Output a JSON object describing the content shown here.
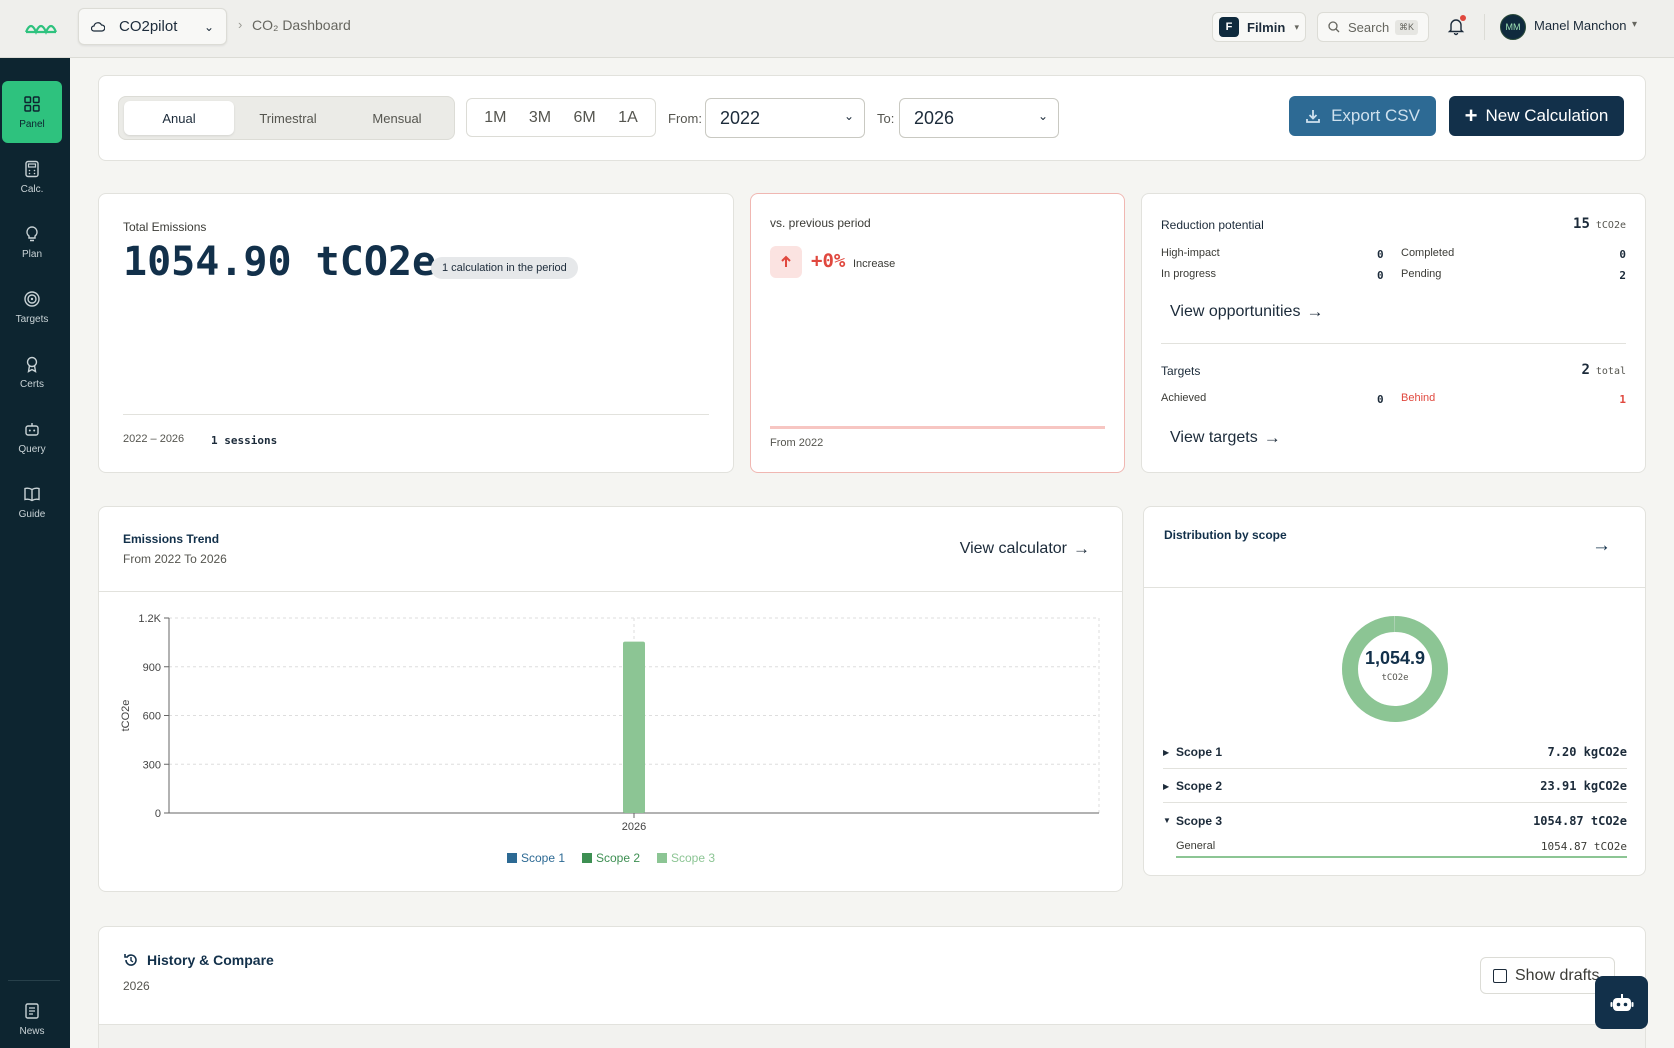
{
  "topbar": {
    "app_name": "CO2pilot",
    "breadcrumb": "CO₂ Dashboard",
    "org_initial": "F",
    "org_name": "Filmin",
    "search_label": "Search",
    "search_shortcut": "⌘K",
    "user_initials": "MM",
    "user_name": "Manel Manchon"
  },
  "sidebar": {
    "items": [
      {
        "label": "Panel",
        "icon": "grid-icon"
      },
      {
        "label": "Calc.",
        "icon": "calculator-icon"
      },
      {
        "label": "Plan",
        "icon": "lightbulb-icon"
      },
      {
        "label": "Targets",
        "icon": "target-icon"
      },
      {
        "label": "Certs",
        "icon": "award-icon"
      },
      {
        "label": "Query",
        "icon": "robot-icon"
      },
      {
        "label": "Guide",
        "icon": "book-icon"
      }
    ],
    "footer": {
      "label": "News",
      "icon": "newspaper-icon"
    }
  },
  "filters": {
    "periods": [
      "Anual",
      "Trimestral",
      "Mensual"
    ],
    "active_period": "Anual",
    "ranges": [
      "1M",
      "3M",
      "6M",
      "1A"
    ],
    "from_label": "From:",
    "from_value": "2022",
    "to_label": "To:",
    "to_value": "2026",
    "export_label": "Export CSV",
    "new_label": "New Calculation"
  },
  "total": {
    "title": "Total Emissions",
    "value": "1054.90 tCO2e",
    "badge": "1 calculation in the period",
    "range": "2022 – 2026",
    "sessions": "1 sessions"
  },
  "comparison": {
    "title": "vs. previous period",
    "change": "+0%",
    "change_label": "Increase",
    "footer": "From 2022"
  },
  "reduction": {
    "title": "Reduction potential",
    "total": "15",
    "total_unit": "tCO2e",
    "high_impact_label": "High-impact",
    "high_impact": "0",
    "completed_label": "Completed",
    "completed": "0",
    "in_progress_label": "In progress",
    "in_progress": "0",
    "pending_label": "Pending",
    "pending": "2",
    "link": "View opportunities"
  },
  "targets": {
    "title": "Targets",
    "total": "2",
    "total_unit": "total",
    "achieved_label": "Achieved",
    "achieved": "0",
    "behind_label": "Behind",
    "behind": "1",
    "link": "View targets"
  },
  "trend": {
    "title": "Emissions Trend",
    "subtitle": "From 2022 To 2026",
    "link": "View calculator"
  },
  "chart_data": {
    "type": "bar",
    "categories": [
      "2026"
    ],
    "series": [
      {
        "name": "Scope 1",
        "values": [
          0.0072
        ],
        "color": "#2d6a94"
      },
      {
        "name": "Scope 2",
        "values": [
          0.02391
        ],
        "color": "#3d8f52"
      },
      {
        "name": "Scope 3",
        "values": [
          1054.87
        ],
        "color": "#8cc594"
      }
    ],
    "ylabel": "tCO2e",
    "ylim": [
      0,
      1200
    ],
    "yticks": [
      "0",
      "300",
      "600",
      "900",
      "1.2K"
    ],
    "grid": true,
    "legend": "bottom"
  },
  "distribution": {
    "title": "Distribution by scope",
    "center_value": "1,054.9",
    "center_unit": "tCO2e",
    "donut_fraction": 0.9971,
    "scopes": [
      {
        "name": "Scope 1",
        "value": "7.20 kgCO2e",
        "expanded": false
      },
      {
        "name": "Scope 2",
        "value": "23.91 kgCO2e",
        "expanded": false
      },
      {
        "name": "Scope 3",
        "value": "1054.87 tCO2e",
        "expanded": true
      }
    ],
    "sub_item": {
      "name": "General",
      "value": "1054.87 tCO2e"
    }
  },
  "history": {
    "title": "History & Compare",
    "year": "2026",
    "show_drafts": "Show drafts"
  },
  "colors": {
    "accent": "#2ec27e",
    "navy": "#12304a",
    "danger": "#e0483e",
    "scope3": "#8cc594"
  }
}
